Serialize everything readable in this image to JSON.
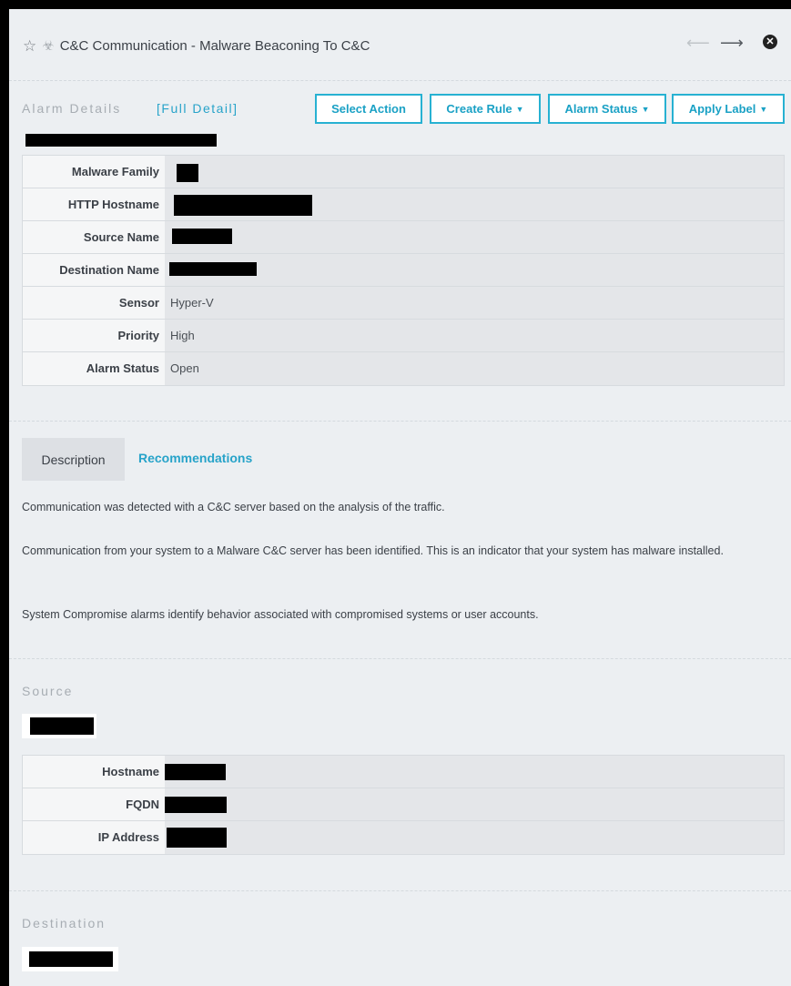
{
  "header": {
    "title": "C&C Communication - Malware Beaconing To C&C",
    "icons": [
      "star-icon",
      "biohazard-icon",
      "arrow-left-icon",
      "arrow-right-icon",
      "close-icon"
    ]
  },
  "alarm_details": {
    "section_title": "Alarm Details",
    "full_detail_link": "[Full Detail]",
    "buttons": {
      "select_action": "Select Action",
      "create_rule": "Create Rule",
      "alarm_status": "Alarm Status",
      "apply_label": "Apply Label"
    },
    "rows": [
      {
        "key": "Malware Family",
        "value": ""
      },
      {
        "key": "HTTP Hostname",
        "value": ""
      },
      {
        "key": "Source Name",
        "value": ""
      },
      {
        "key": "Destination Name",
        "value": ""
      },
      {
        "key": "Sensor",
        "value": "Hyper-V"
      },
      {
        "key": "Priority",
        "value": "High"
      },
      {
        "key": "Alarm Status",
        "value": "Open"
      }
    ]
  },
  "tabs": {
    "description": "Description",
    "recommendations": "Recommendations"
  },
  "description": {
    "p1": "Communication was detected with a C&C server based on the analysis of the traffic.",
    "p2": "Communication from your system to a Malware C&C server has been identified. This is an indicator that your system has malware installed.",
    "p3": "System Compromise alarms identify behavior associated with compromised systems or user accounts."
  },
  "source": {
    "section_title": "Source",
    "rows": [
      {
        "key": "Hostname",
        "value": ""
      },
      {
        "key": "FQDN",
        "value": ""
      },
      {
        "key": "IP Address",
        "value": ""
      }
    ]
  },
  "destination": {
    "section_title": "Destination"
  }
}
